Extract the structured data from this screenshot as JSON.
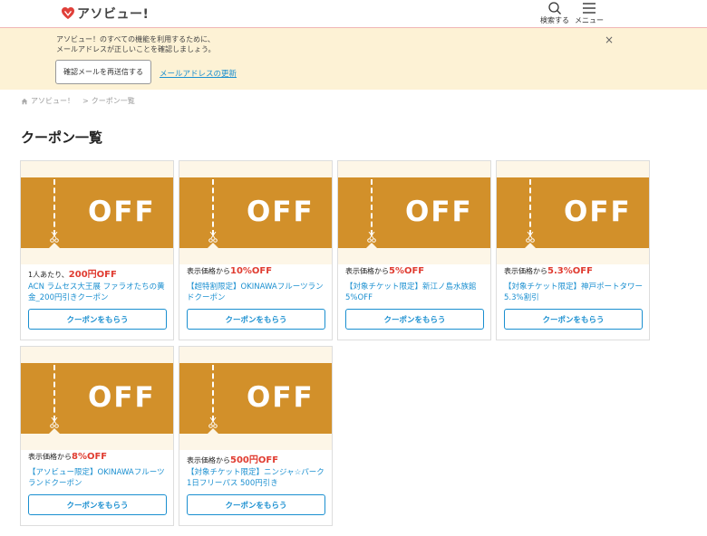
{
  "header": {
    "logo_text": "アソビュー!",
    "search_label": "検索する",
    "menu_label": "メニュー"
  },
  "notice": {
    "line1": "アソビュー！のすべての機能を利用するために、",
    "line2": "メールアドレスが正しいことを確認しましょう。",
    "resend_label": "確認メールを再送信する",
    "update_link": "メールアドレスの更新",
    "close_glyph": "×"
  },
  "breadcrumb": {
    "home": "アソビュー！",
    "separator": ">",
    "current": "クーポン一覧"
  },
  "page_title": "クーポン一覧",
  "ticket_text": "OFF",
  "coupons": [
    {
      "prefix": "1人あたり、",
      "amount": "200円OFF",
      "name": "ACN ラムセス大王展 ファラオたちの黄金_200円引きクーポン",
      "button": "クーポンをもらう"
    },
    {
      "prefix": "表示価格から",
      "amount": "10%OFF",
      "name": "【超特割限定】OKINAWAフルーツランドクーポン",
      "button": "クーポンをもらう"
    },
    {
      "prefix": "表示価格から",
      "amount": "5%OFF",
      "name": "【対象チケット限定】新江ノ島水族館5%OFF",
      "button": "クーポンをもらう"
    },
    {
      "prefix": "表示価格から",
      "amount": "5.3%OFF",
      "name": "【対象チケット限定】神戸ポートタワー5.3%割引",
      "button": "クーポンをもらう"
    },
    {
      "prefix": "表示価格から",
      "amount": "8%OFF",
      "name": "【アソビュー限定】OKINAWAフルーツランドクーポン",
      "button": "クーポンをもらう"
    },
    {
      "prefix": "表示価格から",
      "amount": "500円OFF",
      "name": "【対象チケット限定】ニンジャ☆パーク1日フリーパス 500円引き",
      "button": "クーポンをもらう"
    }
  ],
  "colors": {
    "ticket": "#d2902a",
    "ticket_bg": "#fdf6e7",
    "notice_bg": "#fdf2d5",
    "link": "#1a8fd0",
    "discount": "#e03c31",
    "logo": "#e0403a"
  },
  "icons": {
    "logo": "heart-logo-icon",
    "search": "search-icon",
    "menu": "hamburger-menu-icon",
    "home": "home-icon",
    "close": "close-icon",
    "scissors": "scissors-icon"
  }
}
